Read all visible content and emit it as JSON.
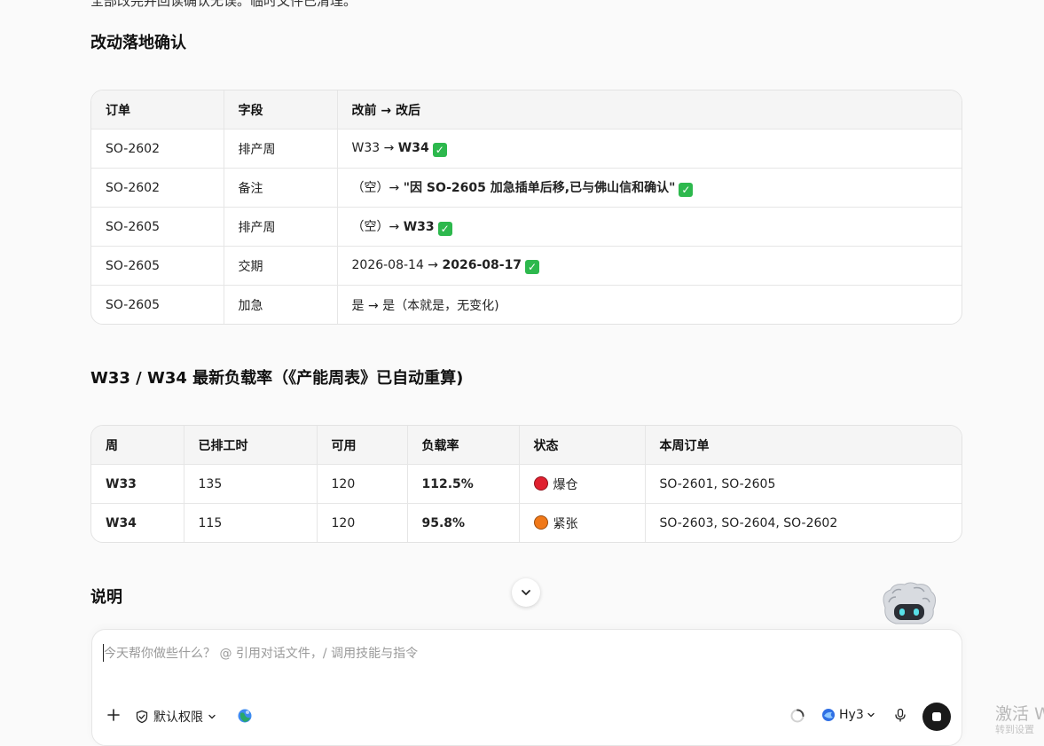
{
  "top_cut_text": "全部改完并回读确认无误。临时文件已清理。",
  "section1": {
    "title": "改动落地确认",
    "headers": [
      "订单",
      "字段",
      "改前 → 改后"
    ],
    "rows": [
      {
        "order": "SO-2602",
        "field": "排产周",
        "before": "W33 → ",
        "after": "W34",
        "tail": "",
        "checked": true
      },
      {
        "order": "SO-2602",
        "field": "备注",
        "before": "（空）→ ",
        "after": "\"因 SO-2605 加急插单后移,已与佛山信和确认\"",
        "tail": "",
        "checked": true
      },
      {
        "order": "SO-2605",
        "field": "排产周",
        "before": "（空）→ ",
        "after": "W33",
        "tail": "",
        "checked": true
      },
      {
        "order": "SO-2605",
        "field": "交期",
        "before": "2026-08-14 → ",
        "after": "2026-08-17",
        "tail": "",
        "checked": true
      },
      {
        "order": "SO-2605",
        "field": "加急",
        "before": "是 → 是（本就是，无变化)",
        "after": "",
        "tail": "",
        "checked": false
      }
    ]
  },
  "section2": {
    "title": "W33 / W34 最新负载率（《产能周表》已自动重算)",
    "headers": [
      "周",
      "已排工时",
      "可用",
      "负载率",
      "状态",
      "本周订单"
    ],
    "rows": [
      {
        "week": "W33",
        "scheduled": "135",
        "available": "120",
        "load": "112.5%",
        "status": "爆仓",
        "status_color": "#e0202f",
        "orders": "SO-2601, SO-2605"
      },
      {
        "week": "W34",
        "scheduled": "115",
        "available": "120",
        "load": "95.8%",
        "status": "紧张",
        "status_color": "#f07818",
        "orders": "SO-2603, SO-2604, SO-2602"
      }
    ]
  },
  "section3": {
    "title": "说明"
  },
  "composer": {
    "placeholder": "今天帮你做些什么？ @ 引用对话文件，/ 调用技能与指令",
    "permission_label": "默认权限",
    "model_label": "Hy3"
  },
  "watermark": {
    "line1": "激活 W",
    "line2": "转到设置"
  },
  "colors": {
    "check": "#2db84d",
    "danger": "#e0202f",
    "warning": "#f07818"
  }
}
